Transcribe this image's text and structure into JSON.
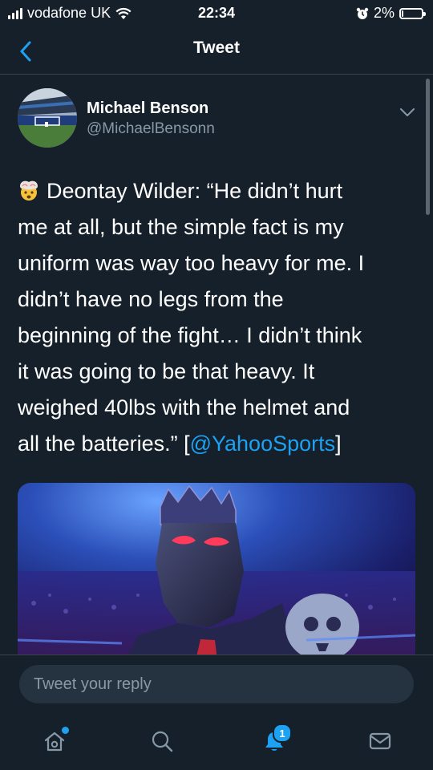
{
  "status_bar": {
    "carrier": "vodafone UK",
    "time": "22:34",
    "battery_percent": "2%",
    "battery_level": 0.02
  },
  "nav": {
    "title": "Tweet",
    "back_icon": "chevron-left-icon"
  },
  "tweet": {
    "author_name": "Michael Benson",
    "author_handle": "@MichaelBensonn",
    "emoji_icon": "exploding-head-emoji",
    "text_lines": [
      "Deontay Wilder: “He didn’t hurt",
      "me at all, but the simple fact is my",
      "uniform was way too heavy for me. I",
      "didn’t have no legs from the",
      "beginning of the fight… I didn’t think",
      "it was going to be that heavy. It",
      "weighed 40lbs with the helmet and",
      "all the batteries.” ["
    ],
    "mention": "@YahooSports",
    "after_mention": "]"
  },
  "reply": {
    "placeholder": "Tweet your reply"
  },
  "tab_bar": {
    "items": [
      {
        "name": "home",
        "icon": "home-icon",
        "has_dot": true
      },
      {
        "name": "search",
        "icon": "search-icon"
      },
      {
        "name": "notifications",
        "icon": "bell-icon",
        "badge": "1"
      },
      {
        "name": "messages",
        "icon": "envelope-icon"
      }
    ]
  },
  "colors": {
    "background": "#15202b",
    "accent": "#1da1f2",
    "secondary_text": "#8899a6",
    "divider": "#38444d"
  }
}
